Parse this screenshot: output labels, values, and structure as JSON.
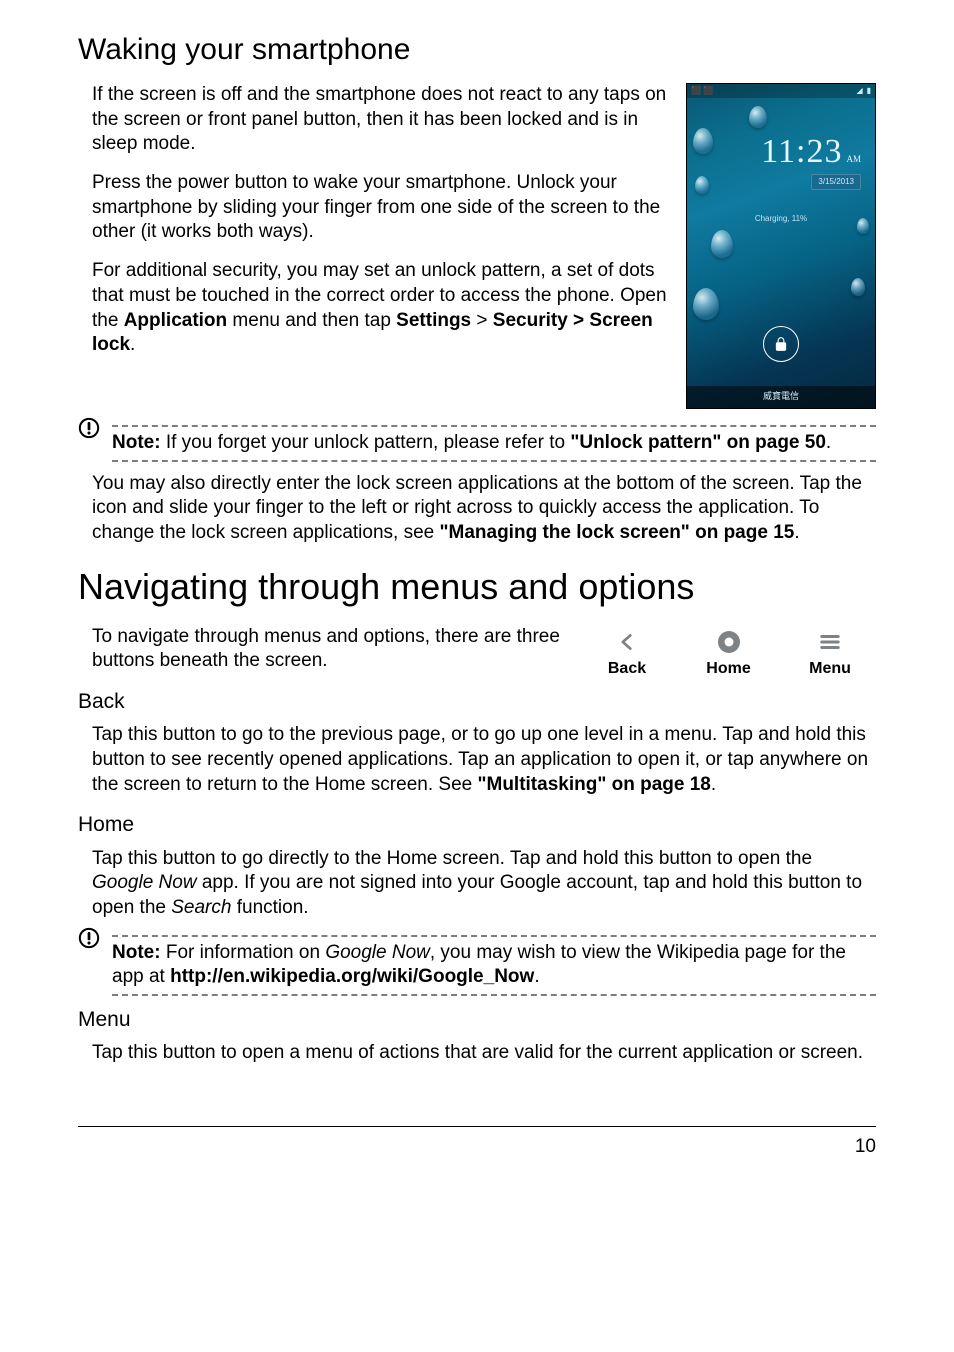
{
  "h2_waking": "Waking your smartphone",
  "p_waking_1": "If the screen is off and the smartphone does not react to any taps on the screen or front panel button, then it has been locked and is in sleep mode.",
  "p_waking_2": "Press the power button to wake your smartphone. Unlock your smartphone by sliding your finger from one side of the screen to the other (it works both ways).",
  "p_waking_3a": "For additional security, you may set an unlock pattern, a set of dots that must be touched in the correct order to access the phone. Open the ",
  "p_waking_3b": "Application",
  "p_waking_3c": " menu and then tap ",
  "p_waking_3d": "Settings",
  "p_waking_3e": " > ",
  "p_waking_3f": "Security > Screen lock",
  "p_waking_3g": ".",
  "note1_label": "Note:",
  "note1_text": " If you forget your unlock pattern, please refer to ",
  "note1_bold": "\"Unlock pattern\" on page 50",
  "note1_end": ".",
  "p_lockapps_a": "You may also directly enter the lock screen applications at the bottom of the screen. Tap the icon and slide your finger to the left or right across to quickly access the application. To change the lock screen applications, see ",
  "p_lockapps_b": "\"Managing the lock screen\" on page 15",
  "p_lockapps_c": ".",
  "h1_nav": "Navigating through menus and options",
  "p_nav_intro": "To navigate through menus and options, there are three buttons beneath the screen.",
  "nav": {
    "back": "Back",
    "home": "Home",
    "menu": "Menu"
  },
  "sub_back": "Back",
  "p_back_a": "Tap this button to go to the previous page, or to go up one level in a menu.  Tap and hold this button to see recently opened applications. Tap an application to open it, or tap anywhere on the screen to return to the Home screen. See ",
  "p_back_b": "\"Multitasking\" on page 18",
  "p_back_c": ".",
  "sub_home": "Home",
  "p_home_a": "Tap this button to go directly to the Home screen. Tap and hold this button to open the ",
  "p_home_b": "Google Now",
  "p_home_c": " app. If you are not signed into your Google account, tap and hold this button to open the ",
  "p_home_d": "Search",
  "p_home_e": " function.",
  "note2_label": "Note:",
  "note2_a": " For information on ",
  "note2_b": "Google Now",
  "note2_c": ", you may wish to view the Wikipedia page for the app at ",
  "note2_d": "http://en.wikipedia.org/wiki/Google_Now",
  "note2_e": ".",
  "sub_menu": "Menu",
  "p_menu": "Tap this button to open a menu of actions that are valid for the current application or screen.",
  "page_number": "10",
  "lockscreen": {
    "time": "11:23",
    "ampm": "AM",
    "date": "3/15/2013",
    "charging": "Charging, 11%",
    "carrier": "威寶電信"
  },
  "chart_data": null
}
